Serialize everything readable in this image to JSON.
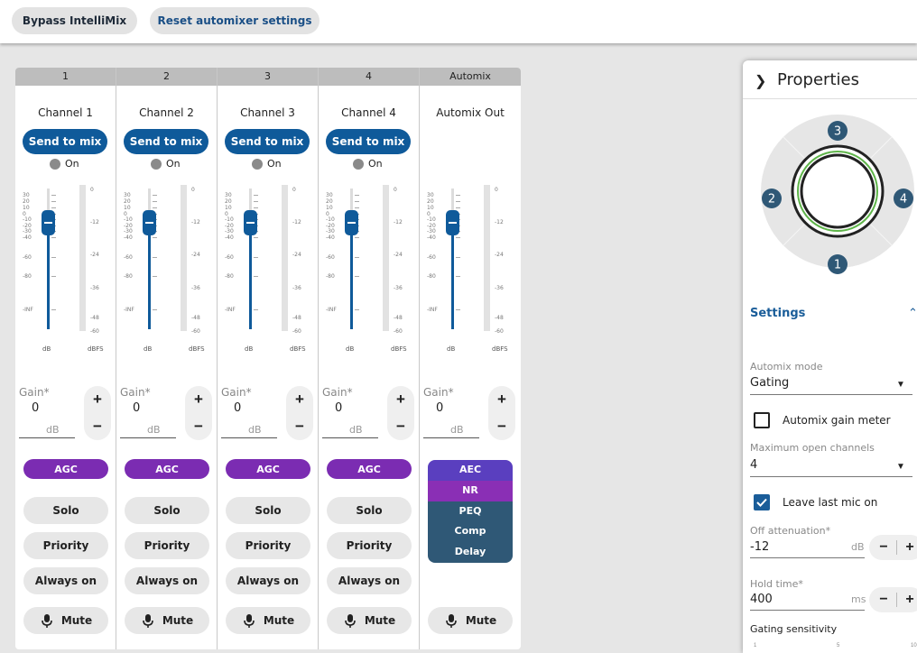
{
  "toolbar": {
    "bypass_label": "Bypass IntelliMix",
    "reset_label": "Reset automixer settings"
  },
  "strips": [
    {
      "header": "1",
      "name": "Channel 1",
      "send_label": "Send to mix",
      "on_label": "On",
      "gain_label": "Gain*",
      "gain_value": "0",
      "gain_unit": "dB",
      "agc_label": "AGC",
      "solo_label": "Solo",
      "priority_label": "Priority",
      "always_label": "Always on",
      "mute_label": "Mute"
    },
    {
      "header": "2",
      "name": "Channel 2",
      "send_label": "Send to mix",
      "on_label": "On",
      "gain_label": "Gain*",
      "gain_value": "0",
      "gain_unit": "dB",
      "agc_label": "AGC",
      "solo_label": "Solo",
      "priority_label": "Priority",
      "always_label": "Always on",
      "mute_label": "Mute"
    },
    {
      "header": "3",
      "name": "Channel 3",
      "send_label": "Send to mix",
      "on_label": "On",
      "gain_label": "Gain*",
      "gain_value": "0",
      "gain_unit": "dB",
      "agc_label": "AGC",
      "solo_label": "Solo",
      "priority_label": "Priority",
      "always_label": "Always on",
      "mute_label": "Mute"
    },
    {
      "header": "4",
      "name": "Channel 4",
      "send_label": "Send to mix",
      "on_label": "On",
      "gain_label": "Gain*",
      "gain_value": "0",
      "gain_unit": "dB",
      "agc_label": "AGC",
      "solo_label": "Solo",
      "priority_label": "Priority",
      "always_label": "Always on",
      "mute_label": "Mute"
    }
  ],
  "automix": {
    "header": "Automix",
    "name": "Automix Out",
    "gain_label": "Gain*",
    "gain_value": "0",
    "gain_unit": "dB",
    "blocks": [
      {
        "label": "AEC",
        "color": "#5a3fbf"
      },
      {
        "label": "NR",
        "color": "#8a2fb5"
      },
      {
        "label": "PEQ",
        "color": "#2f5876"
      },
      {
        "label": "Comp",
        "color": "#2f5876"
      },
      {
        "label": "Delay",
        "color": "#2f5876"
      }
    ],
    "mute_label": "Mute"
  },
  "fader": {
    "scale_labels": [
      "30",
      "20",
      "10",
      "0",
      "-10",
      "-20",
      "-30",
      "-40",
      "-60",
      "-80",
      "-INF"
    ],
    "meter_labels": [
      "0",
      "-12",
      "-24",
      "-36",
      "-48",
      "-60"
    ],
    "unit_fader": "dB",
    "unit_meter": "dBFS",
    "level_db": "0"
  },
  "properties": {
    "title": "Properties",
    "radar_labels": [
      "3",
      "2",
      "4",
      "1"
    ],
    "settings_title": "Settings",
    "automix_mode_label": "Automix mode",
    "automix_mode_value": "Gating",
    "gain_meter_label": "Automix gain meter",
    "gain_meter_checked": false,
    "max_open_label": "Maximum open channels",
    "max_open_value": "4",
    "leave_last_label": "Leave last mic on",
    "leave_last_checked": true,
    "off_atten_label": "Off attenuation*",
    "off_atten_value": "-12",
    "off_atten_unit": "dB",
    "hold_label": "Hold time*",
    "hold_value": "400",
    "hold_unit": "ms",
    "gating_label": "Gating sensitivity",
    "gating_ticks": [
      "1",
      "5",
      "10"
    ]
  },
  "colors": {
    "accent": "#0f5a9a",
    "agc": "#7b2cb2",
    "settings_blue": "#1a5d99"
  }
}
